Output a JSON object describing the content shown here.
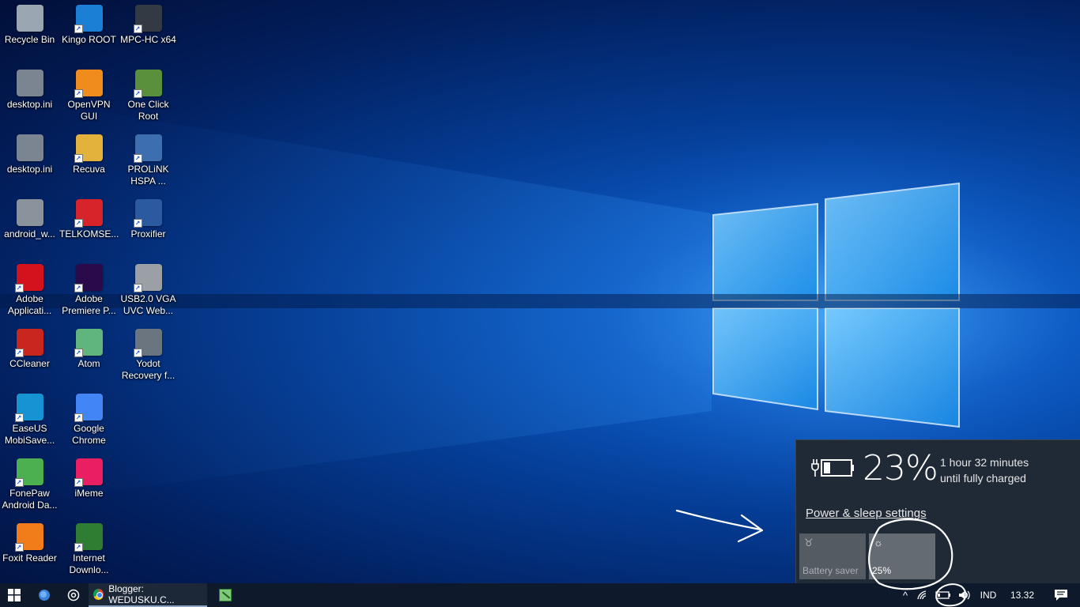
{
  "desktop": {
    "columns": [
      [
        {
          "label": "Recycle Bin",
          "icon": "recycle-bin-icon",
          "color": "#9aa7b3"
        },
        {
          "label": "desktop.ini",
          "icon": "settings-file-icon",
          "color": "#7b8591"
        },
        {
          "label": "desktop.ini",
          "icon": "settings-file-icon",
          "color": "#7b8591"
        },
        {
          "label": "android_w...",
          "icon": "settings-file-icon",
          "color": "#8a939c"
        },
        {
          "label": "Adobe\nApplicati...",
          "icon": "adobe-icon",
          "color": "#d4121e"
        },
        {
          "label": "CCleaner",
          "icon": "ccleaner-icon",
          "color": "#c8261e"
        },
        {
          "label": "EaseUS\nMobiSave...",
          "icon": "easeus-icon",
          "color": "#1593d2"
        },
        {
          "label": "FonePaw\nAndroid Da...",
          "icon": "fonepaw-icon",
          "color": "#4caf50"
        },
        {
          "label": "Foxit Reader",
          "icon": "foxit-icon",
          "color": "#f07d1a"
        }
      ],
      [
        {
          "label": "Kingo ROOT",
          "icon": "kingo-root-icon",
          "color": "#1c7fd6"
        },
        {
          "label": "OpenVPN\nGUI",
          "icon": "openvpn-icon",
          "color": "#f08c1e"
        },
        {
          "label": "Recuva",
          "icon": "recuva-icon",
          "color": "#e3b23c"
        },
        {
          "label": "TELKOMSE...",
          "icon": "telkomsel-icon",
          "color": "#d6242a"
        },
        {
          "label": "Adobe\nPremiere P...",
          "icon": "premiere-icon",
          "color": "#2a0a4a"
        },
        {
          "label": "Atom",
          "icon": "atom-icon",
          "color": "#5fb57d"
        },
        {
          "label": "Google\nChrome",
          "icon": "chrome-icon",
          "color": "#4285f4"
        },
        {
          "label": "iMeme",
          "icon": "imeme-icon",
          "color": "#e91e63"
        },
        {
          "label": "Internet\nDownlo...",
          "icon": "idm-icon",
          "color": "#2e7d32"
        }
      ],
      [
        {
          "label": "MPC-HC x64",
          "icon": "mpc-hc-icon",
          "color": "#333a44"
        },
        {
          "label": "One Click\nRoot",
          "icon": "one-click-root-icon",
          "color": "#5a8f3c"
        },
        {
          "label": "PROLiNK\nHSPA ...",
          "icon": "prolink-icon",
          "color": "#3d6fb0"
        },
        {
          "label": "Proxifier",
          "icon": "proxifier-icon",
          "color": "#2c5aa0"
        },
        {
          "label": "USB2.0 VGA\nUVC Web...",
          "icon": "webcam-icon",
          "color": "#9aa0a6"
        },
        {
          "label": "Yodot\nRecovery f...",
          "icon": "yodot-icon",
          "color": "#6b7580"
        }
      ]
    ]
  },
  "battery_flyout": {
    "percent": "23%",
    "time_line1": "1 hour 32 minutes",
    "time_line2": "until fully charged",
    "settings_link": "Power & sleep settings",
    "tile_saver_label": "Battery saver",
    "tile_brightness_label": "25%"
  },
  "taskbar": {
    "chrome_window_title": "Blogger: WEDUSKU.C...",
    "tray_chevron": "^",
    "language": "IND",
    "clock": "13.32"
  },
  "colors": {
    "taskbar_bg": "#0e1a2b",
    "flyout_bg": "#1f2a36",
    "tile_bg": "#5a6168"
  }
}
